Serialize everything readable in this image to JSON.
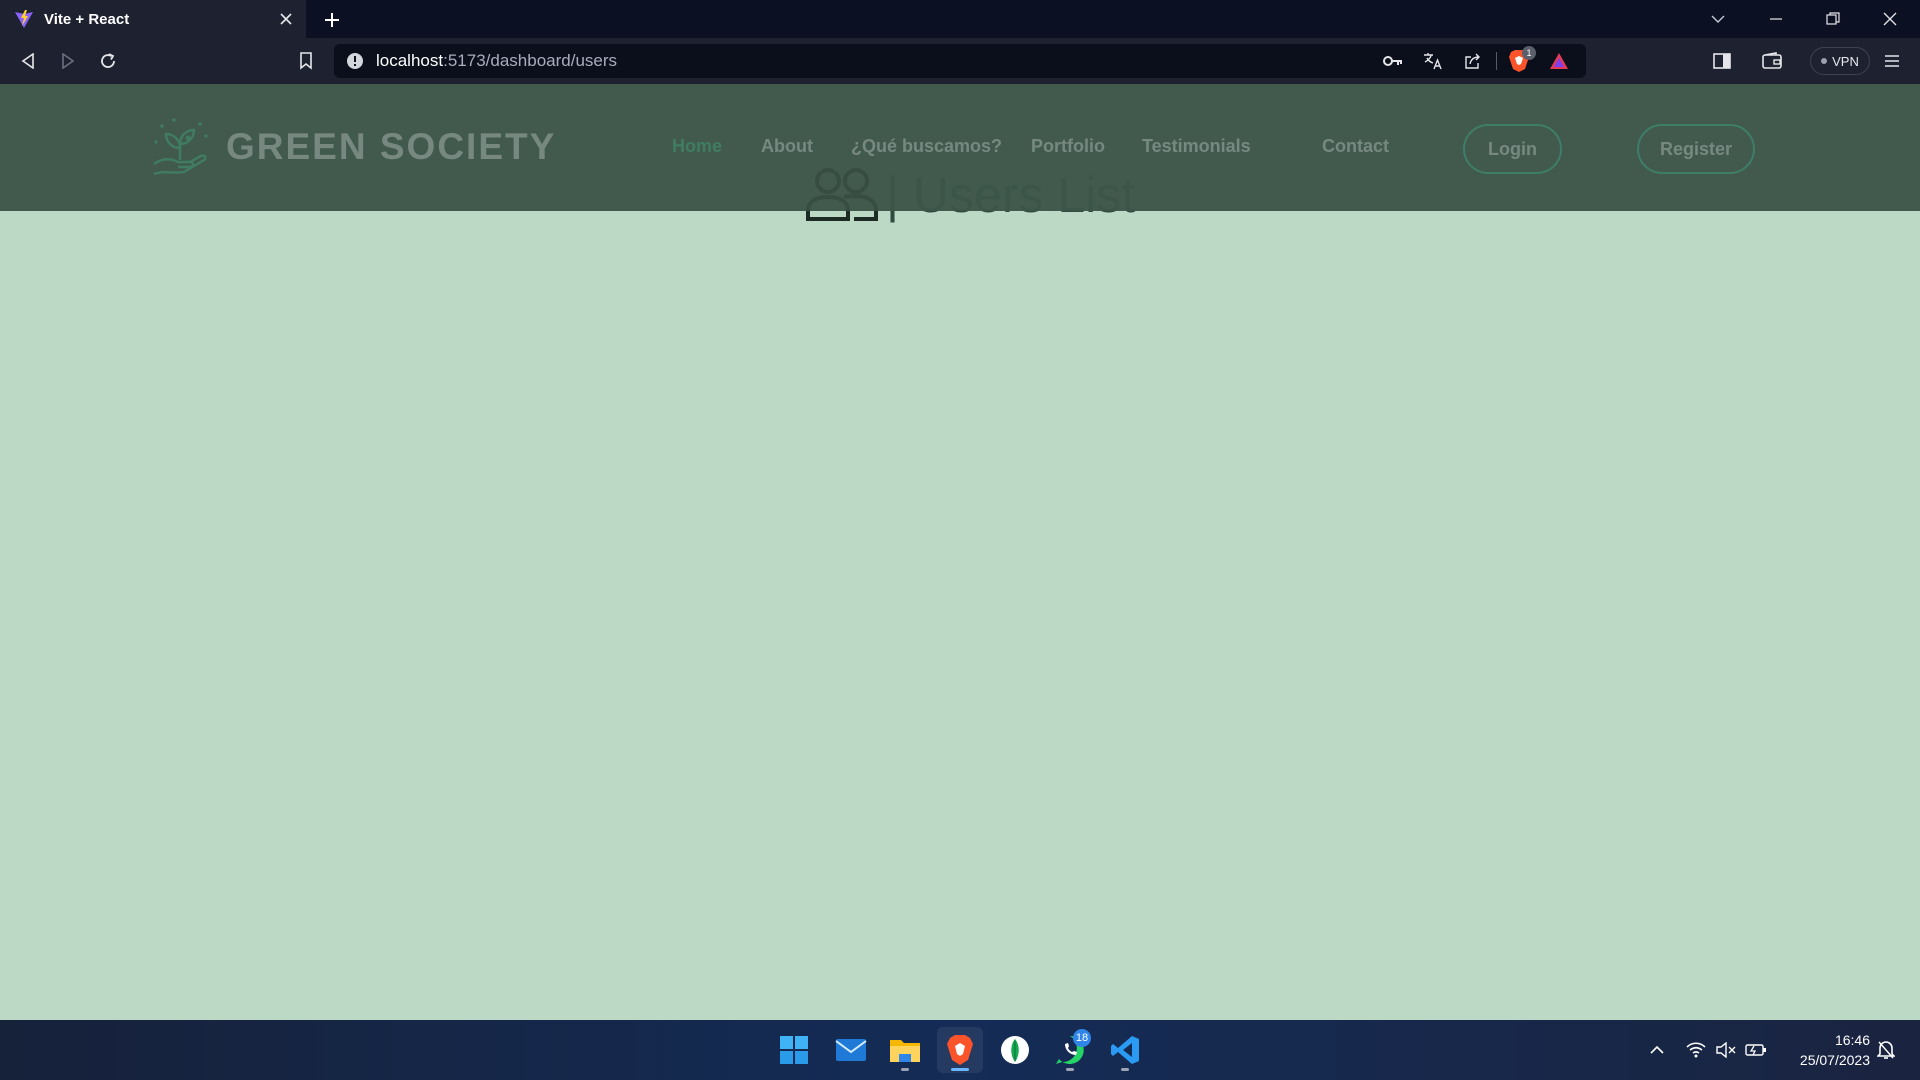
{
  "browser": {
    "tab_title": "Vite + React",
    "url_host": "localhost",
    "url_path": ":5173/dashboard/users",
    "vpn_label": "VPN",
    "brave_badge": "1"
  },
  "site": {
    "brand": "GREEN SOCIETY",
    "nav": [
      {
        "label": "Home",
        "active": true
      },
      {
        "label": "About"
      },
      {
        "label": "¿Qué buscamos?"
      },
      {
        "label": "Portfolio"
      },
      {
        "label": "Testimonials"
      },
      {
        "label": "Contact"
      }
    ],
    "login_label": "Login",
    "register_label": "Register",
    "page_heading": "| Users List",
    "colors": {
      "header_bg": "#415a4d",
      "page_bg": "#bcd9c6",
      "accent": "#3fd394",
      "button_border": "#38d6ae"
    }
  },
  "taskbar": {
    "apps": [
      "windows-start",
      "mail",
      "file-explorer",
      "brave",
      "mongodb-compass",
      "whatsapp",
      "vscode"
    ],
    "whatsapp_badge": "18",
    "time": "16:46",
    "date": "25/07/2023"
  }
}
